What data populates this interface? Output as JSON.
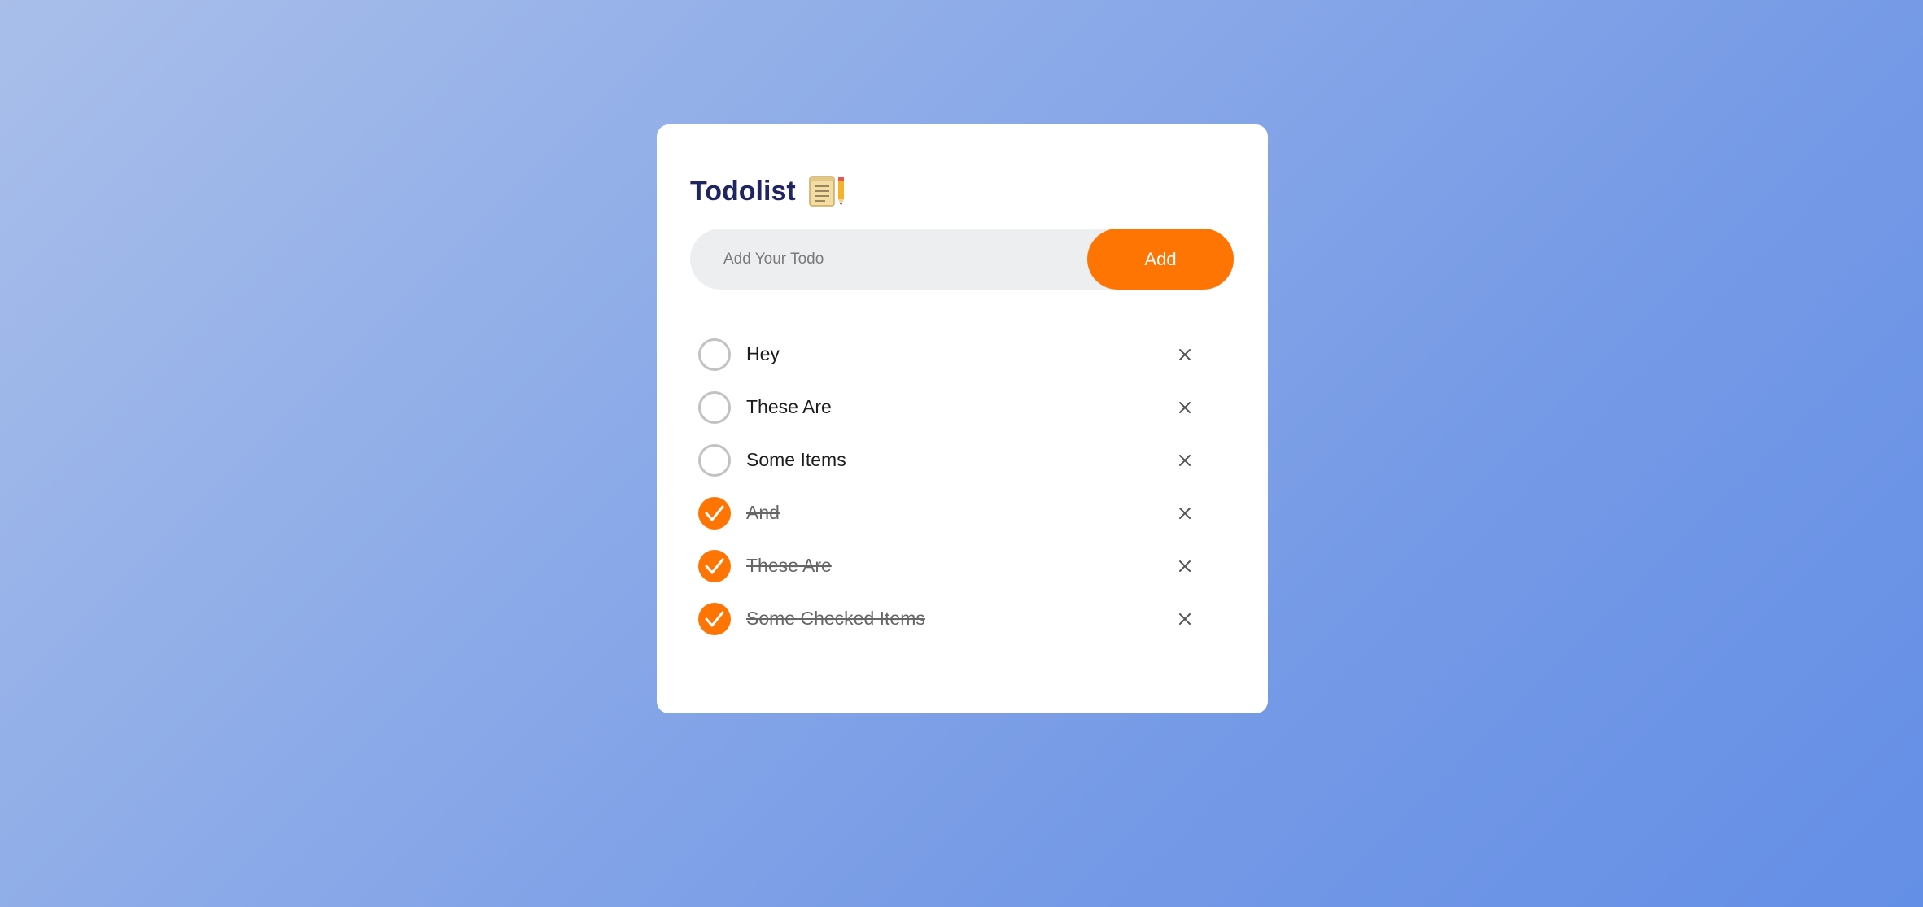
{
  "app": {
    "title": "Todolist",
    "title_icon": "notepad-pencil-icon"
  },
  "input": {
    "placeholder": "Add Your Todo",
    "value": ""
  },
  "add_button": {
    "label": "Add"
  },
  "colors": {
    "accent": "#ff7504",
    "title": "#1f2463",
    "background_start": "#a9bfea",
    "background_end": "#648fe6"
  },
  "todos": [
    {
      "text": "Hey",
      "checked": false
    },
    {
      "text": "These Are",
      "checked": false
    },
    {
      "text": "Some Items",
      "checked": false
    },
    {
      "text": "And",
      "checked": true
    },
    {
      "text": "These Are",
      "checked": true
    },
    {
      "text": "Some Checked Items",
      "checked": true
    }
  ],
  "icons": {
    "checkbox": "check-circle-icon",
    "delete": "close-icon"
  }
}
